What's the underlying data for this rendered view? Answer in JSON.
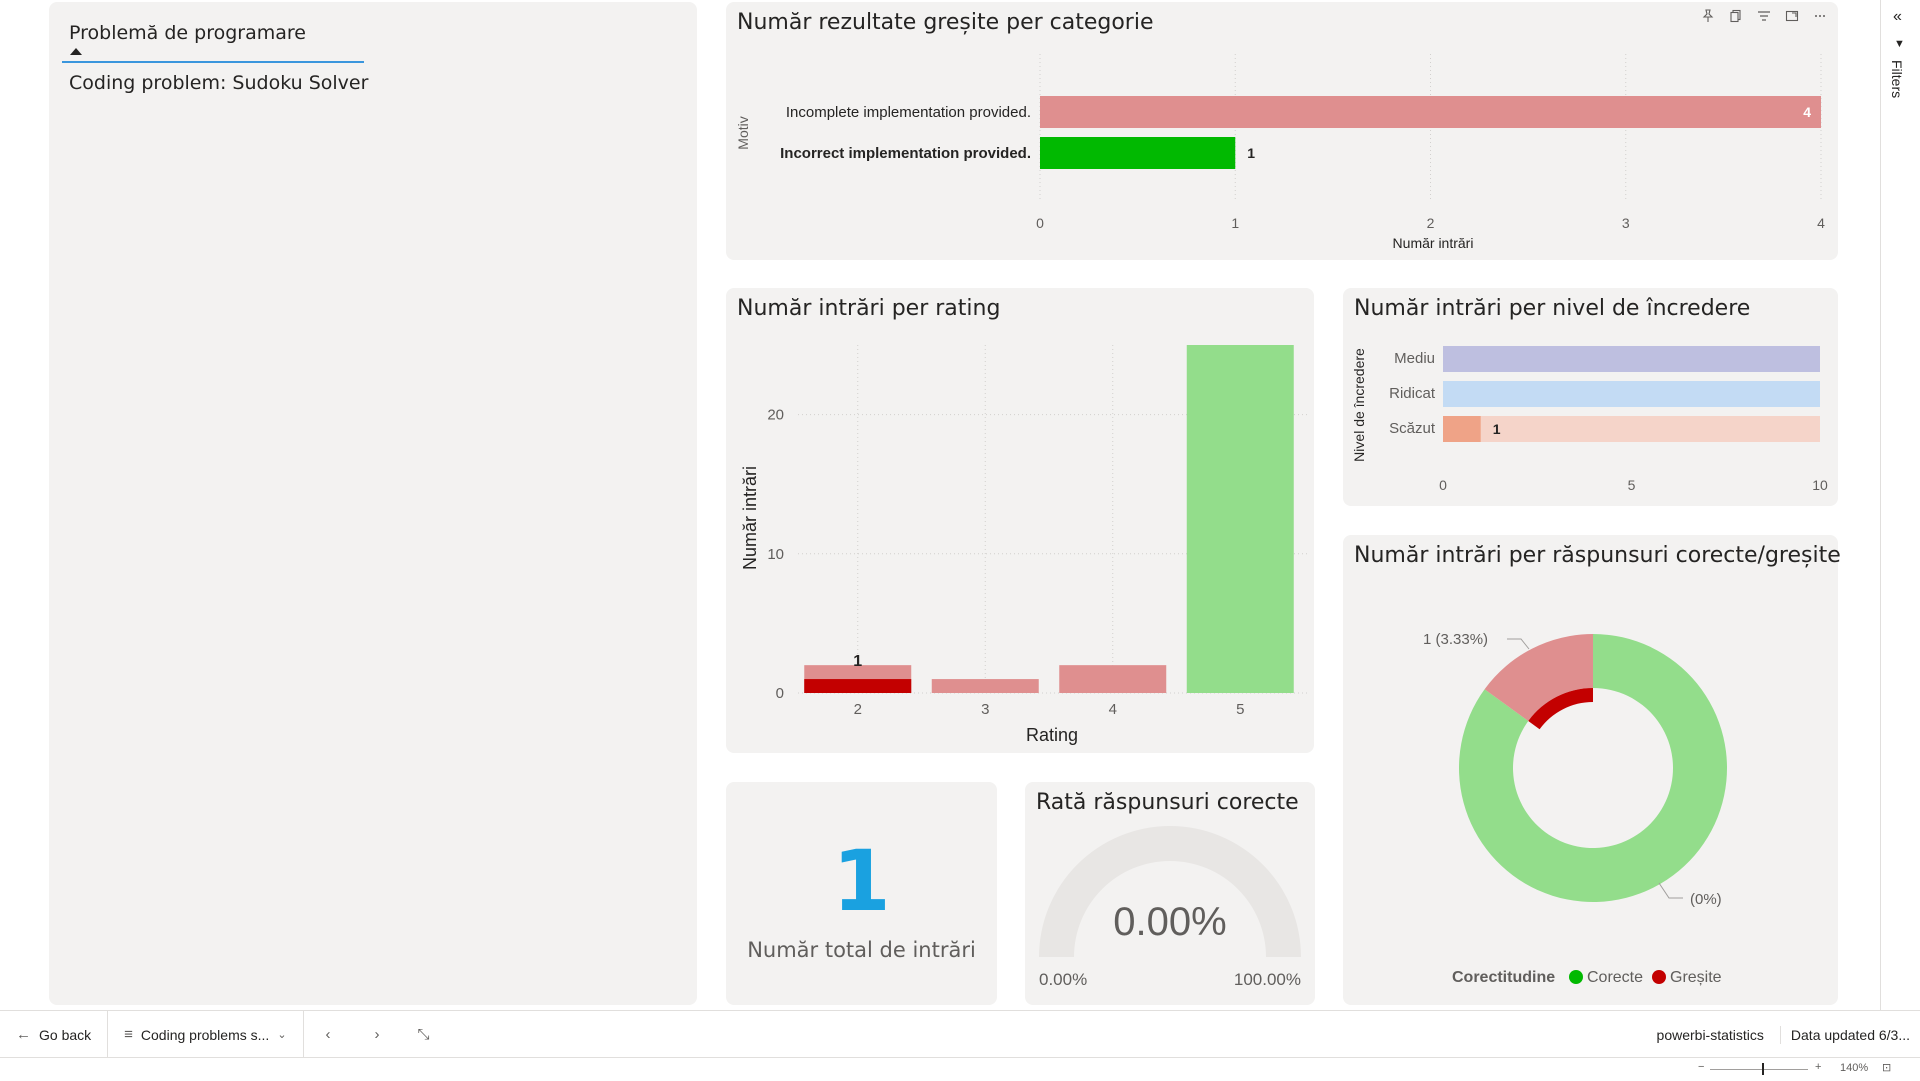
{
  "slicer": {
    "title": "Problemă de programare",
    "item": "Coding problem: Sudoku Solver"
  },
  "visual_header": {
    "icons": [
      "pin-icon",
      "copy-icon",
      "filter-icon",
      "focus-mode-icon",
      "more-options-icon"
    ]
  },
  "charts": {
    "wrong_by_category": {
      "title": "Număr rezultate greșite per categorie",
      "ylabel": "Motiv",
      "xlabel": "Număr intrări",
      "ticks": [
        "0",
        "1",
        "2",
        "3",
        "4"
      ],
      "categories": [
        "Incomplete implementation provided.",
        "Incorrect implementation provided."
      ],
      "data_labels": [
        "4",
        "1"
      ]
    },
    "entries_by_rating": {
      "title": "Număr intrări per rating",
      "ylabel": "Număr intrări",
      "xlabel": "Rating",
      "yticks": [
        "0",
        "10",
        "20"
      ],
      "categories": [
        "2",
        "3",
        "4",
        "5"
      ],
      "data_label": "1"
    },
    "entries_by_confidence": {
      "title": "Număr intrări per nivel de încredere",
      "ylabel": "Nivel de încredere",
      "categories": [
        "Mediu",
        "Ridicat",
        "Scăzut"
      ],
      "ticks": [
        "0",
        "5",
        "10"
      ],
      "data_label": "1"
    },
    "correct_wrong": {
      "title": "Număr intrări per răspunsuri corecte/greșite",
      "label_outer": "1 (3.33%)",
      "label_inner": "(0%)",
      "legend_title": "Corectitudine",
      "legend": [
        "Corecte",
        "Greșite"
      ]
    },
    "correct_rate": {
      "title": "Rată răspunsuri corecte",
      "value": "0.00%",
      "min_label": "0.00%",
      "max_label": "100.00%"
    }
  },
  "kpi": {
    "value": "1",
    "label": "Număr total de intrări"
  },
  "filters_pane": {
    "label": "Filters"
  },
  "bottom_bar": {
    "go_back": "Go back",
    "page_name": "Coding problems s...",
    "workspace": "powerbi-statistics",
    "updated": "Data updated 6/3..."
  },
  "status_bar": {
    "zoom": "140%"
  },
  "colors": {
    "pink": "#df8f8f",
    "green": "#01b901",
    "light_green": "#93dd8b",
    "dark_red": "#c30000",
    "lavender": "#bebfe0",
    "light_blue": "#c3dbf4",
    "peach": "#efa387",
    "light_peach": "#f5d4c9",
    "kpi_blue": "#1aa1e0"
  },
  "chart_data": [
    {
      "type": "bar",
      "title": "Număr rezultate greșite per categorie",
      "categories": [
        "Incomplete implementation provided.",
        "Incorrect implementation provided."
      ],
      "values": [
        4,
        1
      ],
      "xlabel": "Număr intrări",
      "ylabel": "Motiv",
      "xlim": [
        0,
        4
      ],
      "grid": true
    },
    {
      "type": "bar",
      "title": "Număr intrări per rating",
      "categories": [
        "2",
        "3",
        "4",
        "5"
      ],
      "series": [
        {
          "values": [
            2,
            1,
            2,
            25
          ]
        },
        {
          "values": [
            1,
            0,
            0,
            0
          ]
        }
      ],
      "xlabel": "Rating",
      "ylabel": "Număr intrări",
      "ylim": [
        0,
        25
      ],
      "grid": true
    },
    {
      "type": "bar",
      "title": "Număr intrări per nivel de încredere",
      "categories": [
        "Mediu",
        "Ridicat",
        "Scăzut"
      ],
      "series": [
        {
          "values": [
            10,
            10,
            10
          ]
        },
        {
          "values": [
            0,
            0,
            1
          ]
        }
      ],
      "ylabel": "Nivel de încredere",
      "xlim": [
        0,
        10
      ]
    },
    {
      "type": "pie",
      "title": "Număr intrări per răspunsuri corecte/greșite",
      "outer_ring": {
        "labels": [
          "Corecte",
          "Greșite"
        ],
        "values": [
          96.67,
          3.33
        ]
      },
      "inner_ring": {
        "labels": [
          "Corecte",
          "Greșite"
        ],
        "values": [
          100,
          0
        ]
      },
      "legend": [
        "Corecte",
        "Greșite"
      ],
      "legend_placement": "bottom"
    },
    {
      "type": "gauge",
      "title": "Rată răspunsuri corecte",
      "value": 0.0,
      "min": 0,
      "max": 100
    }
  ]
}
